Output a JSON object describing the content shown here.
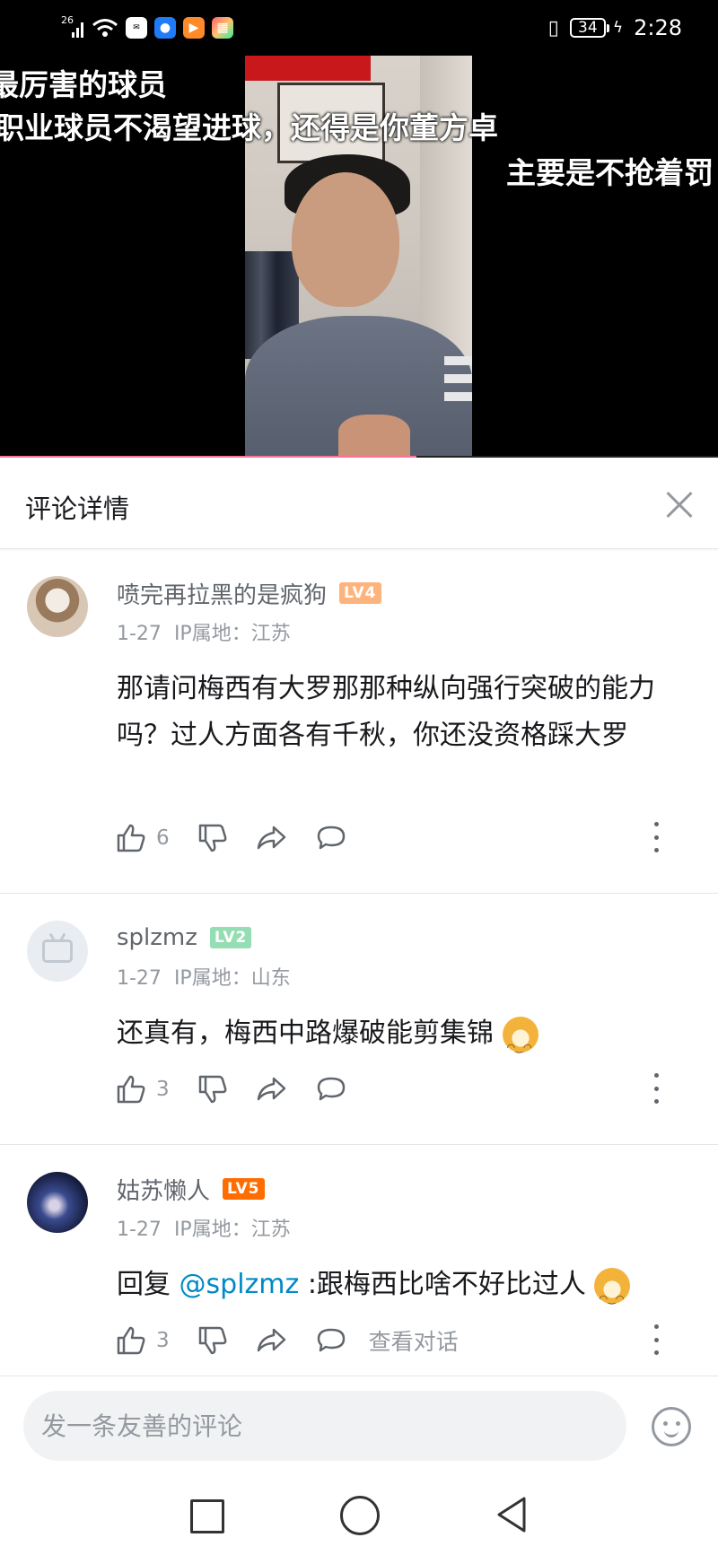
{
  "status_bar": {
    "signal_label": "26",
    "battery": "34",
    "time": "2:28"
  },
  "video": {
    "subtitles": [
      "最厉害的球员",
      "职业球员不渴望进球，还得是你董方卓",
      "主要是不抢着罚"
    ],
    "progress": 0.58,
    "progress_color": "#fb7299"
  },
  "panel": {
    "title": "评论详情"
  },
  "comments": [
    {
      "username": "喷完再拉黑的是疯狗",
      "level": "LV4",
      "level_color": "#ffb37c",
      "date": "1-27",
      "ip": "IP属地：江苏",
      "text": "那请问梅西有大罗那那种纵向强行突破的能力吗？过人方面各有千秋，你还没资格踩大罗",
      "likes": "6"
    },
    {
      "username": "splzmz",
      "level": "LV2",
      "level_color": "#95ddb2",
      "date": "1-27",
      "ip": "IP属地：山东",
      "text": "还真有，梅西中路爆破能剪集锦",
      "likes": "3"
    },
    {
      "username": "姑苏懒人",
      "level": "LV5",
      "level_color": "#ff6c00",
      "date": "1-27",
      "ip": "IP属地：江苏",
      "reply_prefix": "回复 ",
      "mention": "@splzmz",
      "text": " :跟梅西比啥不好比过人",
      "likes": "3",
      "view_conversation": "查看对话"
    }
  ],
  "input": {
    "placeholder": "发一条友善的评论"
  }
}
